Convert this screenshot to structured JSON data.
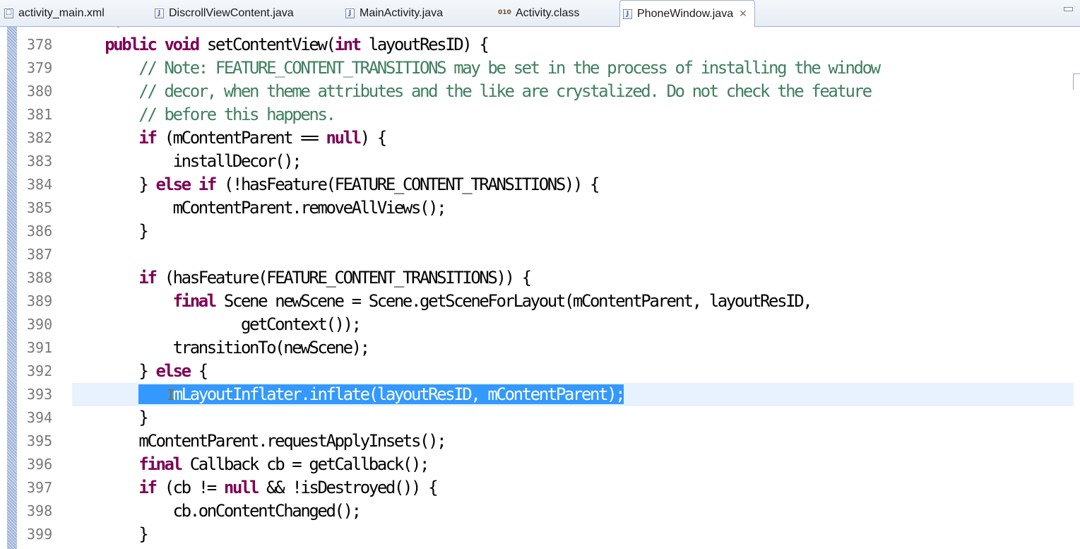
{
  "tabs": [
    {
      "label": "activity_main.xml",
      "icon": "xml-file-icon",
      "glyph": "☐",
      "active": false
    },
    {
      "label": "DiscrollViewContent.java",
      "icon": "java-file-icon",
      "glyph": "J",
      "active": false
    },
    {
      "label": "MainActivity.java",
      "icon": "java-file-icon",
      "glyph": "J",
      "active": false
    },
    {
      "label": "Activity.class",
      "icon": "class-file-icon",
      "glyph": "010",
      "active": false
    },
    {
      "label": "PhoneWindow.java",
      "icon": "java-file-icon",
      "glyph": "J",
      "active": true,
      "close": "✕"
    }
  ],
  "editor": {
    "folded_marker": "˘",
    "current_line": 393,
    "colors": {
      "keyword": "#7f0055",
      "comment": "#3f7f5f",
      "selection": "#3399ff",
      "current_line": "#e8f2fe"
    },
    "lines": [
      {
        "n": "378",
        "tokens": [
          [
            "",
            "    "
          ],
          [
            "kw",
            "public"
          ],
          [
            "",
            " "
          ],
          [
            "kw",
            "void"
          ],
          [
            "",
            " setContentView("
          ],
          [
            "kw",
            "int"
          ],
          [
            "",
            " layoutResID) {"
          ]
        ]
      },
      {
        "n": "379",
        "tokens": [
          [
            "",
            "        "
          ],
          [
            "cm",
            "// Note: FEATURE_CONTENT_TRANSITIONS may be set in the process of installing the window"
          ]
        ]
      },
      {
        "n": "380",
        "tokens": [
          [
            "",
            "        "
          ],
          [
            "cm",
            "// decor, when theme attributes and the like are crystalized. Do not check the feature"
          ]
        ]
      },
      {
        "n": "381",
        "tokens": [
          [
            "",
            "        "
          ],
          [
            "cm",
            "// before this happens."
          ]
        ]
      },
      {
        "n": "382",
        "tokens": [
          [
            "",
            "        "
          ],
          [
            "kw",
            "if"
          ],
          [
            "",
            " (mContentParent == "
          ],
          [
            "kw",
            "null"
          ],
          [
            "",
            ") {"
          ]
        ]
      },
      {
        "n": "383",
        "tokens": [
          [
            "",
            "            installDecor();"
          ]
        ]
      },
      {
        "n": "384",
        "tokens": [
          [
            "",
            "        } "
          ],
          [
            "kw",
            "else"
          ],
          [
            "",
            " "
          ],
          [
            "kw",
            "if"
          ],
          [
            "",
            " (!hasFeature(FEATURE_CONTENT_TRANSITIONS)) {"
          ]
        ]
      },
      {
        "n": "385",
        "tokens": [
          [
            "",
            "            mContentParent.removeAllViews();"
          ]
        ]
      },
      {
        "n": "386",
        "tokens": [
          [
            "",
            "        }"
          ]
        ]
      },
      {
        "n": "387",
        "tokens": [
          [
            "",
            ""
          ]
        ]
      },
      {
        "n": "388",
        "tokens": [
          [
            "",
            "        "
          ],
          [
            "kw",
            "if"
          ],
          [
            "",
            " (hasFeature(FEATURE_CONTENT_TRANSITIONS)) {"
          ]
        ]
      },
      {
        "n": "389",
        "tokens": [
          [
            "",
            "            "
          ],
          [
            "kw",
            "final"
          ],
          [
            "",
            " Scene newScene = Scene.getSceneForLayout(mContentParent, layoutResID,"
          ]
        ]
      },
      {
        "n": "390",
        "tokens": [
          [
            "",
            "                    getContext());"
          ]
        ]
      },
      {
        "n": "391",
        "tokens": [
          [
            "",
            "            transitionTo(newScene);"
          ]
        ]
      },
      {
        "n": "392",
        "tokens": [
          [
            "",
            "        } "
          ],
          [
            "kw",
            "else"
          ],
          [
            "",
            " {"
          ]
        ]
      },
      {
        "n": "393",
        "tokens": [
          [
            "",
            "        "
          ],
          [
            "sel",
            "    mLayoutInflater.inflate(layoutResID, mContentParent);"
          ]
        ]
      },
      {
        "n": "394",
        "tokens": [
          [
            "",
            "        }"
          ]
        ]
      },
      {
        "n": "395",
        "tokens": [
          [
            "",
            "        mContentParent.requestApplyInsets();"
          ]
        ]
      },
      {
        "n": "396",
        "tokens": [
          [
            "",
            "        "
          ],
          [
            "kw",
            "final"
          ],
          [
            "",
            " Callback cb = getCallback();"
          ]
        ]
      },
      {
        "n": "397",
        "tokens": [
          [
            "",
            "        "
          ],
          [
            "kw",
            "if"
          ],
          [
            "",
            " (cb != "
          ],
          [
            "kw",
            "null"
          ],
          [
            "",
            " && !isDestroyed()) {"
          ]
        ]
      },
      {
        "n": "398",
        "tokens": [
          [
            "",
            "            cb.onContentChanged();"
          ]
        ]
      },
      {
        "n": "399",
        "tokens": [
          [
            "",
            "        }"
          ]
        ]
      }
    ]
  },
  "text_cursor_glyph": "I"
}
